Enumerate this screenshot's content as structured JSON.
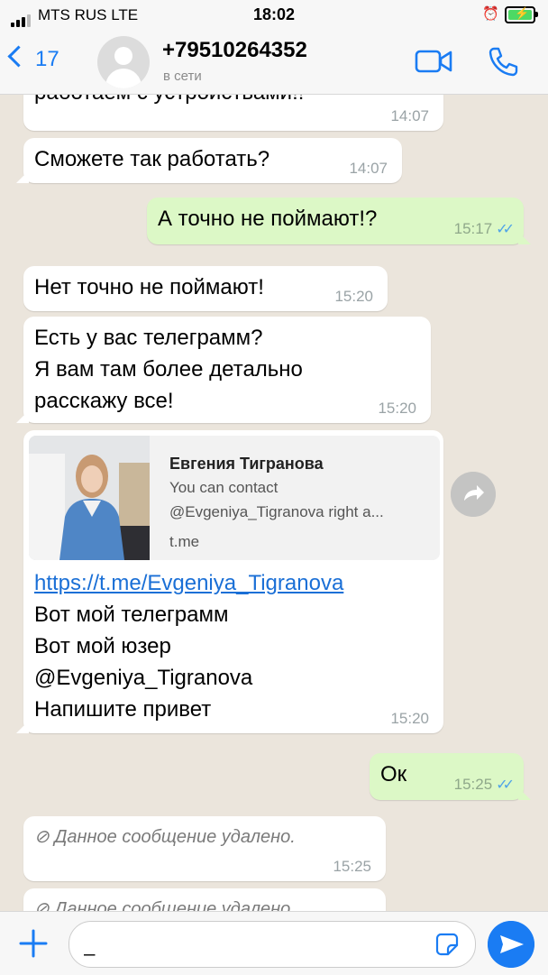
{
  "status_bar": {
    "carrier": "MTS RUS  LTE",
    "time": "18:02"
  },
  "header": {
    "back_count": "17",
    "contact_name": "+79510264352",
    "contact_status": "в сети"
  },
  "messages": [
    {
      "dir": "in",
      "lines": [
        "работаем с устройствами!!"
      ],
      "time": "14:07"
    },
    {
      "dir": "in",
      "lines": [
        "Сможете так работать?"
      ],
      "time": "14:07"
    },
    {
      "dir": "out",
      "lines": [
        "А точно не поймают!?"
      ],
      "time": "15:17"
    },
    {
      "dir": "in",
      "lines": [
        "Нет точно не поймают!"
      ],
      "time": "15:20"
    },
    {
      "dir": "in",
      "lines": [
        "Есть у вас телеграмм?",
        "Я вам там более детально",
        "расскажу все!"
      ],
      "time": "15:20"
    },
    {
      "dir": "in",
      "link": "https://t.me/Evgeniya_Tigranova",
      "lines": [
        "Вот мой телеграмм",
        "Вот мой юзер",
        "@Evgeniya_Tigranova",
        "Напишите привет"
      ],
      "time": "15:20"
    },
    {
      "dir": "out",
      "lines": [
        "Ок"
      ],
      "time": "15:25"
    },
    {
      "dir": "in",
      "deleted": true,
      "lines": [
        "Данное сообщение удалено."
      ],
      "time": "15:25"
    },
    {
      "dir": "in",
      "deleted": true,
      "lines": [
        "Данное сообщение удалено."
      ],
      "time": ""
    }
  ],
  "link_preview": {
    "title": "Евгения Тигранова",
    "description": "You can contact @Evgeniya_Tigranova right a...",
    "domain": "t.me"
  },
  "composer": {
    "value": "_"
  },
  "colors": {
    "accent": "#1a7cf3",
    "outgoing": "#dcf8c6",
    "incoming": "#ffffff",
    "read_ticks": "#4fa3e8"
  },
  "icons": [
    "back-chevron-icon",
    "video-call-icon",
    "phone-icon",
    "plus-icon",
    "sticker-icon",
    "send-icon",
    "forward-icon",
    "deleted-icon"
  ]
}
